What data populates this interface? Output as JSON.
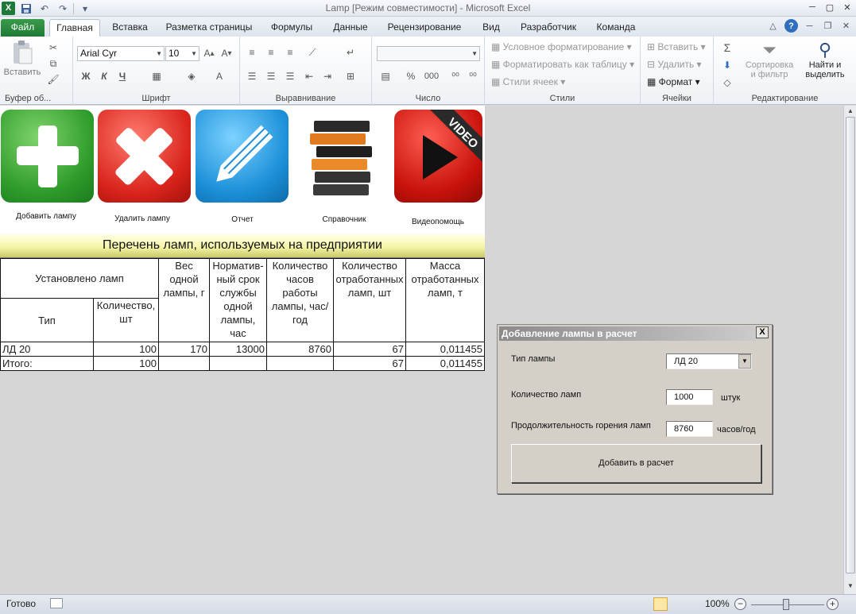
{
  "window": {
    "title": "Lamp  [Режим совместимости]  -  Microsoft Excel"
  },
  "qat": {
    "app_icon": "X"
  },
  "tabs": [
    {
      "label": "Файл"
    },
    {
      "label": "Главная"
    },
    {
      "label": "Вставка"
    },
    {
      "label": "Разметка страницы"
    },
    {
      "label": "Формулы"
    },
    {
      "label": "Данные"
    },
    {
      "label": "Рецензирование"
    },
    {
      "label": "Вид"
    },
    {
      "label": "Разработчик"
    },
    {
      "label": "Команда"
    }
  ],
  "ribbon": {
    "clipboard": {
      "label": "Буфер об...",
      "paste": "Вставить"
    },
    "font": {
      "label": "Шрифт",
      "font_name": "Arial Cyr",
      "font_size": "10",
      "bold": "Ж",
      "italic": "К",
      "underline": "Ч"
    },
    "alignment": {
      "label": "Выравнивание"
    },
    "number": {
      "label": "Число",
      "percent": "%",
      "thousands": "000"
    },
    "styles": {
      "label": "Стили",
      "conditional": "Условное форматирование",
      "as_table": "Форматировать как таблицу",
      "cell_styles": "Стили ячеек"
    },
    "cells": {
      "label": "Ячейки",
      "insert": "Вставить",
      "delete": "Удалить",
      "format": "Формат"
    },
    "editing": {
      "label": "Редактирование",
      "sort_line1": "Сортировка",
      "sort_line2": "и фильтр",
      "find_line1": "Найти и",
      "find_line2": "выделить"
    }
  },
  "sheet": {
    "buttons": [
      {
        "caption": "Добавить лампу"
      },
      {
        "caption": "Удалить лампу"
      },
      {
        "caption": "Отчет"
      },
      {
        "caption": "Справочник"
      },
      {
        "caption": "Видеопомощь",
        "badge": "VIDEO"
      }
    ],
    "heading": "Перечень ламп, используемых  на предприятии",
    "table": {
      "h_installed": "Установлено ламп",
      "h_type": "Тип",
      "h_qty": "Количество, шт",
      "h_weight": "Вес одной лампы, г",
      "h_life": "Норматив-ный срок службы одной лампы, час",
      "h_hours": "Количество часов работы лампы, час/год",
      "h_spent": "Количество отработанных ламп, шт",
      "h_mass": "Масса отработанных ламп, т",
      "rows": [
        {
          "type": "ЛД 20",
          "qty": "100",
          "weight": "170",
          "life": "13000",
          "hours": "8760",
          "spent": "67",
          "mass": "0,011455"
        },
        {
          "type": "Итого:",
          "qty": "100",
          "weight": "",
          "life": "",
          "hours": "",
          "spent": "67",
          "mass": "0,011455"
        }
      ]
    }
  },
  "dialog": {
    "title": "Добавление лампы в расчет",
    "close": "X",
    "type_label": "Тип лампы",
    "type_value": "ЛД 20",
    "qty_label": "Количество ламп",
    "qty_value": "1000",
    "qty_unit": "штук",
    "hours_label": "Продолжительность горения ламп",
    "hours_value": "8760",
    "hours_unit": "часов/год",
    "add_button": "Добавить в расчет"
  },
  "status": {
    "ready": "Готово",
    "zoom": "100%"
  }
}
